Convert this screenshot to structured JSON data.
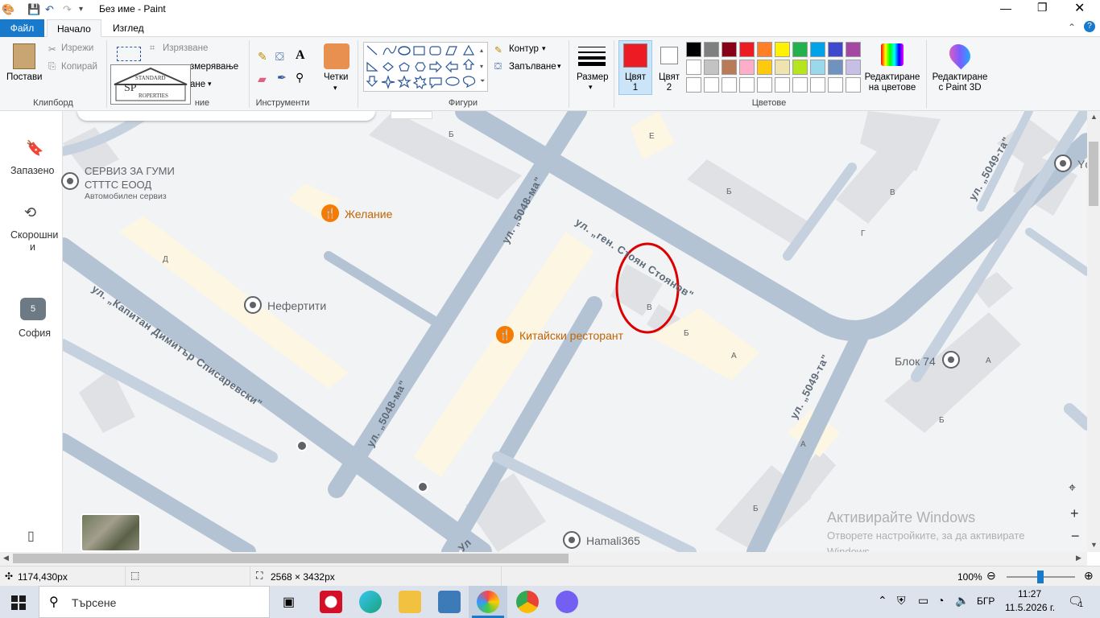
{
  "window": {
    "title": "Без име - Paint"
  },
  "tabs": {
    "file": "Файл",
    "home": "Начало",
    "view": "Изглед"
  },
  "clipboard": {
    "paste": "Постави",
    "cut": "Изрежи",
    "copy": "Копирай",
    "group": "Клипборд"
  },
  "image": {
    "crop": "Изрязване",
    "resize": "змерявање",
    "rotate": "ане",
    "group": "ние"
  },
  "tools": {
    "group": "Инструменти",
    "brushes": "Четки"
  },
  "shapes": {
    "group": "Фигури",
    "outline": "Контур",
    "fill": "Запълване"
  },
  "size": {
    "label": "Размер"
  },
  "colors": {
    "color1": "Цвят 1",
    "color2": "Цвят 2",
    "group": "Цветове",
    "edit": "Редактиране на цветове",
    "paint3d": "Редактиране с Paint 3D",
    "primary": "#ed1c24",
    "secondary": "#ffffff",
    "palette": [
      "#000000",
      "#7f7f7f",
      "#880015",
      "#ed1c24",
      "#ff7f27",
      "#fff200",
      "#22b14c",
      "#00a2e8",
      "#3f48cc",
      "#a349a4",
      "#ffffff",
      "#c3c3c3",
      "#b97a57",
      "#ffaec9",
      "#ffc90e",
      "#efe4b0",
      "#b5e61d",
      "#99d9ea",
      "#7092be",
      "#c8bfe7"
    ]
  },
  "map": {
    "sidebar": {
      "saved": "Запазено",
      "recent": "Скорошни",
      "recent2": "и",
      "sofia": "София",
      "sofia_badge": "5"
    },
    "streets": {
      "s1": "ул. „ген. Стоян Стоянов\"",
      "s2": "ул. „5048-ма\"",
      "s3": "ул. „5049-та\"",
      "s4": "ул. „Капитан Димитър Списаревски\"",
      "s5": "ул. „5048-ма\"",
      "s6": "ул. „5049-та\"",
      "s7": "Ул"
    },
    "pois": {
      "tyre": "СЕРВИЗ ЗА ГУМИ",
      "tyre2": "СТТТС ЕООД",
      "tyre_sub": "Автомобилен сервиз",
      "zhelanie": "Желание",
      "nefertiti": "Нефертити",
      "chinese": "Китайски ресторант",
      "blok": "Блок 74",
      "hamali": "Hamali365",
      "yc": "Yc"
    },
    "letters": {
      "b1": "Б",
      "e": "Е",
      "d": "Д",
      "b2": "Б",
      "v": "В",
      "g": "Г",
      "v2": "В",
      "b3": "Б",
      "a": "А",
      "a2": "А",
      "b4": "Б",
      "a3": "А",
      "b5": "Б"
    },
    "watermark": {
      "title": "Активирайте Windows",
      "sub": "Отворете настройките, за да активирате",
      "sub2": "Windows."
    }
  },
  "statusbar": {
    "cursor": "1174,430px",
    "size": "2568 × 3432px",
    "zoom": "100%"
  },
  "taskbar": {
    "search": "Търсене",
    "lang": "БГР",
    "time": "11:27",
    "date": "11.5.2026 г.",
    "notif": "1"
  }
}
